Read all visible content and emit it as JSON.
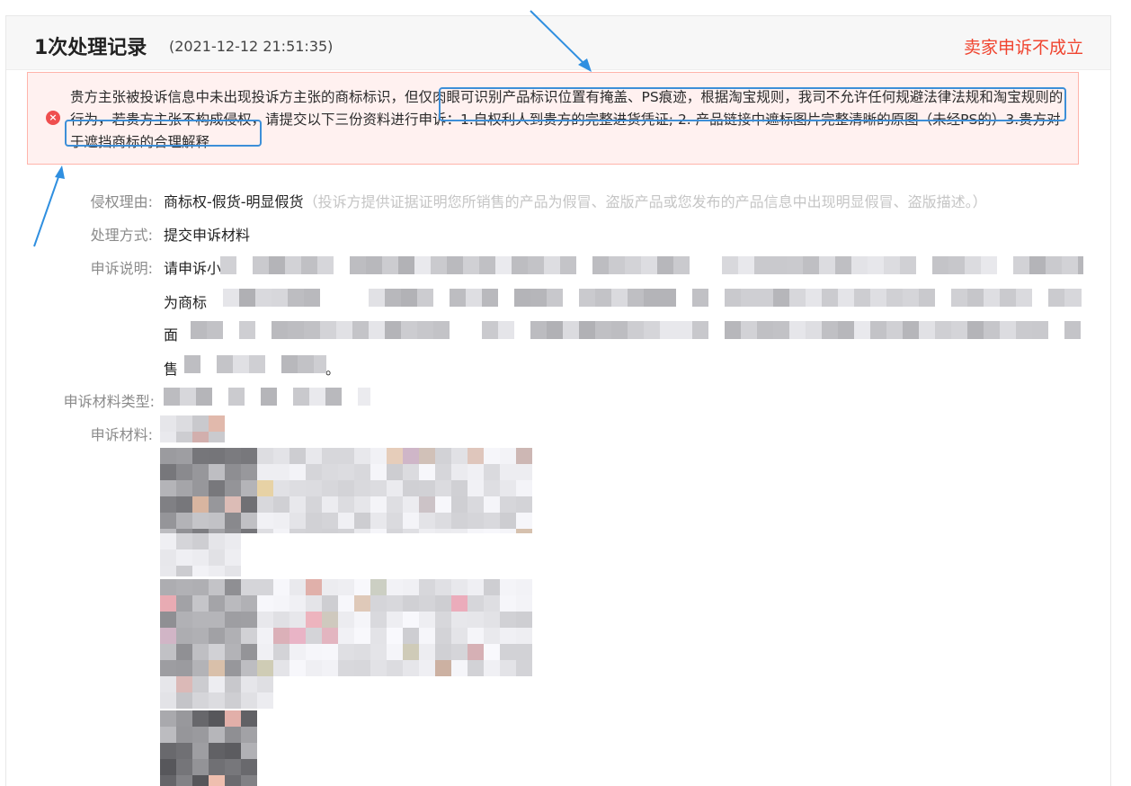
{
  "record": {
    "title": "1次处理记录",
    "time": "(2021-12-12 21:51:35)",
    "status": "卖家申诉不成立"
  },
  "alert": {
    "icon": "error-circle-icon",
    "text": "贵方主张被投诉信息中未出现投诉方主张的商标标识，但仅肉眼可识别产品标识位置有掩盖、PS痕迹，根据淘宝规则，我司不允许任何规避法律法规和淘宝规则的行为，若贵方主张不构成侵权，请提交以下三份资料进行申诉：1.自权利人到贵方的完整进货凭证; 2. 产品链接中遮标图片完整清晰的原图（未经PS的）3.贵方对于遮挡商标的合理解释"
  },
  "fields": {
    "reason_label": "侵权理由:",
    "reason_value": "商标权-假货-明显假货",
    "reason_hint": "（投诉方提供证据证明您所销售的产品为假冒、盗版产品或您发布的产品信息中出现明显假冒、盗版描述。）",
    "method_label": "处理方式:",
    "method_value": "提交申诉材料",
    "explain_label": "申诉说明:",
    "explain_lines": [
      "请申诉小",
      "为商标",
      "面",
      "售",
      "。"
    ],
    "material_type_label": "申诉材料类型:",
    "material_label": "申诉材料:"
  },
  "colors": {
    "status": "#f0442f",
    "alert_bg": "#fff1f0",
    "highlight_border": "#3d8fd8",
    "arrow": "#2f8fe0"
  }
}
